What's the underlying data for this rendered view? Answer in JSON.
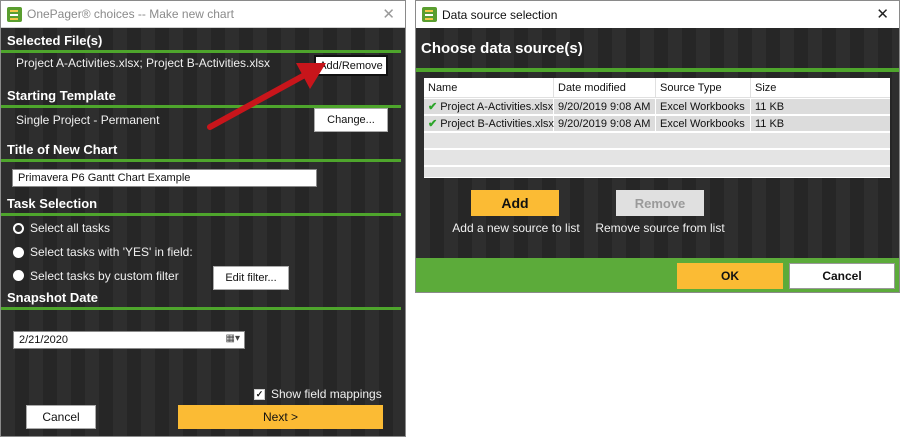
{
  "left_window": {
    "title": "OnePager® choices -- Make new chart",
    "sections": {
      "selected_files": {
        "heading": "Selected File(s)",
        "value": "Project A-Activities.xlsx; Project B-Activities.xlsx",
        "button": "Add/Remove"
      },
      "starting_template": {
        "heading": "Starting Template",
        "value": "Single Project - Permanent",
        "button": "Change..."
      },
      "title_new_chart": {
        "heading": "Title of New Chart",
        "input_value": "Primavera P6 Gantt Chart Example"
      },
      "task_selection": {
        "heading": "Task Selection",
        "options": [
          {
            "label": "Select all tasks",
            "selected": true
          },
          {
            "label": "Select tasks with 'YES' in field:",
            "selected": false
          },
          {
            "label": "Select tasks by custom filter",
            "selected": false
          }
        ],
        "edit_filter_button": "Edit filter..."
      },
      "snapshot_date": {
        "heading": "Snapshot Date",
        "date_value": "2/21/2020"
      }
    },
    "show_field_mappings": {
      "label": "Show field mappings",
      "checked": true
    },
    "cancel_button": "Cancel",
    "next_button": "Next >"
  },
  "right_window": {
    "title": "Data source selection",
    "heading": "Choose data source(s)",
    "table": {
      "columns": [
        "Name",
        "Date modified",
        "Source Type",
        "Size"
      ],
      "rows": [
        {
          "name": "Project A-Activities.xlsx",
          "date": "9/20/2019 9:08 AM",
          "type": "Excel Workbooks",
          "size": "11 KB"
        },
        {
          "name": "Project B-Activities.xlsx",
          "date": "9/20/2019 9:08 AM",
          "type": "Excel Workbooks",
          "size": "11 KB"
        }
      ]
    },
    "add_button": "Add",
    "add_caption": "Add a new source to list",
    "remove_button": "Remove",
    "remove_caption": "Remove source from list",
    "ok_button": "OK",
    "cancel_button": "Cancel"
  },
  "colors": {
    "accent_green": "#4ea52c",
    "accent_yellow": "#fbbb34",
    "dark_bg": "#2b2b2b",
    "arrow_red": "#c8151b"
  },
  "icons": {
    "app": "onepager-app-icon",
    "close": "close-icon",
    "calendar": "calendar-dropdown-icon",
    "check": "green-checkmark-icon",
    "annotation_arrow": "red-arrow-icon"
  }
}
